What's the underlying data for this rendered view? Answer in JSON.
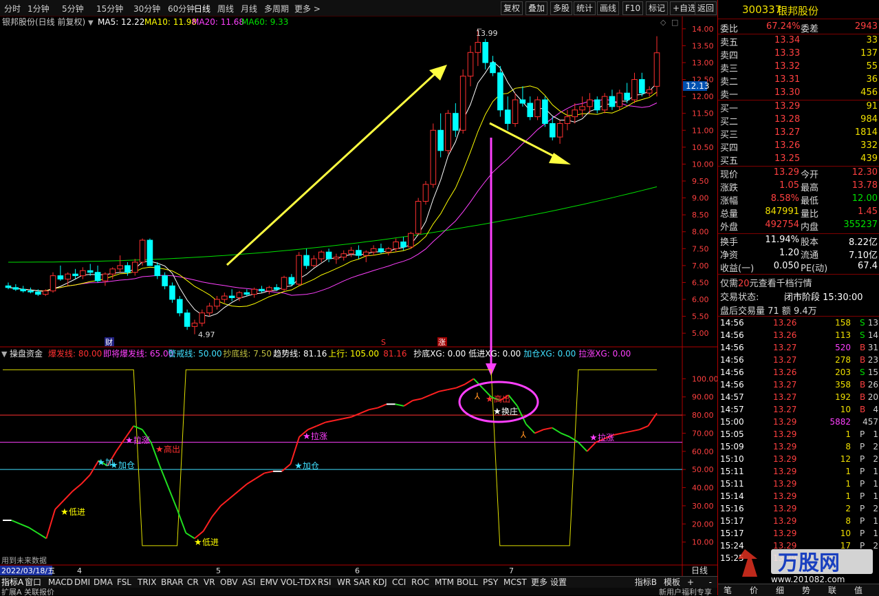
{
  "toolbar": {
    "periods": [
      "分时",
      "1分钟",
      "5分钟",
      "15分钟",
      "30分钟",
      "60分钟",
      "日线",
      "周线",
      "月线",
      "多周期",
      "更多 >"
    ],
    "active_period": "日线",
    "right_tools": [
      "复权",
      "叠加",
      "多股",
      "统计",
      "画线",
      "F10",
      "标记",
      "+自选",
      "返回"
    ]
  },
  "chart_header": {
    "title": "银邦股份(日线 前复权)",
    "ma5": "MA5: 12.22",
    "ma10": "MA10: 11.98",
    "ma20": "MA20: 11.68",
    "ma60": "MA60: 9.33"
  },
  "price_axis": {
    "ticks": [
      "14.00",
      "13.50",
      "13.00",
      "12.50",
      "12.00",
      "11.50",
      "11.00",
      "10.50",
      "10.00",
      "9.50",
      "9.00",
      "8.50",
      "8.00",
      "7.50",
      "7.00",
      "6.50",
      "6.00",
      "5.50",
      "5.00"
    ],
    "current_tag": "12.13",
    "high_marker": "13.99",
    "low_marker": "4.97"
  },
  "event_markers": [
    "财",
    "S",
    "涨"
  ],
  "indicator_header": {
    "name": "操盘资金",
    "items": [
      {
        "text": "爆发线: 80.00",
        "color": "#ff3030"
      },
      {
        "text": "即将爆发线: 65.00",
        "color": "#ff40ff"
      },
      {
        "text": "警戒线: 50.00",
        "color": "#40e0ff"
      },
      {
        "text": "抄底线: 7.50",
        "color": "#c0c040"
      },
      {
        "text": "趋势线: 81.16",
        "color": "#ffffff"
      },
      {
        "text": "上行: 105.00",
        "color": "#ffff00"
      },
      {
        "text": "81.16",
        "color": "#ff3030"
      },
      {
        "text": "抄底XG: 0.00",
        "color": "#ffffff"
      },
      {
        "text": "低进XG: 0.00",
        "color": "#ffffff"
      },
      {
        "text": "加仓XG: 0.00",
        "color": "#40e0ff"
      },
      {
        "text": "拉涨XG: 0.00",
        "color": "#ff40ff"
      }
    ]
  },
  "indicator_axis": {
    "ticks": [
      "100.00",
      "90.00",
      "80.00",
      "70.00",
      "60.00",
      "50.00",
      "40.00",
      "30.00",
      "20.00",
      "10.00"
    ]
  },
  "signals": {
    "low_entry": "低进",
    "add": "加仓",
    "add_short": "加",
    "rally": "拉涨",
    "rally_short": "拉涨",
    "high_out": "高出",
    "switch": "换庄"
  },
  "date_axis": {
    "start": "2022/03/18/五",
    "months": [
      "4",
      "5",
      "6",
      "7"
    ],
    "period_btn": "日线"
  },
  "future_note": "用到未来数据",
  "bottom_tabs": [
    "指标A",
    "窗口",
    "MACD",
    "DMI",
    "DMA",
    "FSL",
    "TRIX",
    "BRAR",
    "CR",
    "VR",
    "OBV",
    "ASI",
    "EMV",
    "VOL-TDX",
    "RSI",
    "WR",
    "SAR",
    "KDJ",
    "CCI",
    "ROC",
    "MTM",
    "BOLL",
    "PSY",
    "MCST",
    "更多",
    "设置"
  ],
  "bottom_right": [
    "指标B",
    "模板",
    "+",
    "-"
  ],
  "status_left": "扩展A  关联报价",
  "status_right": "新用户福利专享",
  "quote": {
    "code": "300337",
    "name": "银邦股份",
    "weibi_label": "委比",
    "weibi": "67.24%",
    "weicha_label": "委差",
    "weicha": "2943",
    "asks": [
      {
        "label": "卖五",
        "price": "13.34",
        "vol": "33"
      },
      {
        "label": "卖四",
        "price": "13.33",
        "vol": "137"
      },
      {
        "label": "卖三",
        "price": "13.32",
        "vol": "55"
      },
      {
        "label": "卖二",
        "price": "13.31",
        "vol": "36"
      },
      {
        "label": "卖一",
        "price": "13.30",
        "vol": "456"
      }
    ],
    "bids": [
      {
        "label": "买一",
        "price": "13.29",
        "vol": "91"
      },
      {
        "label": "买二",
        "price": "13.28",
        "vol": "984"
      },
      {
        "label": "买三",
        "price": "13.27",
        "vol": "1814"
      },
      {
        "label": "买四",
        "price": "13.26",
        "vol": "332"
      },
      {
        "label": "买五",
        "price": "13.25",
        "vol": "439"
      }
    ],
    "stats": [
      {
        "l1": "现价",
        "v1": "13.29",
        "c1": "red",
        "l2": "今开",
        "v2": "12.30",
        "c2": "red"
      },
      {
        "l1": "涨跌",
        "v1": "1.05",
        "c1": "red",
        "l2": "最高",
        "v2": "13.78",
        "c2": "red"
      },
      {
        "l1": "涨幅",
        "v1": "8.58%",
        "c1": "red",
        "l2": "最低",
        "v2": "12.00",
        "c2": "grn"
      },
      {
        "l1": "总量",
        "v1": "847991",
        "c1": "yel",
        "l2": "量比",
        "v2": "1.45",
        "c2": "red"
      },
      {
        "l1": "外盘",
        "v1": "492754",
        "c1": "red",
        "l2": "内盘",
        "v2": "355237",
        "c2": "grn"
      }
    ],
    "stats2": [
      {
        "l1": "换手",
        "v1": "11.94%",
        "l2": "股本",
        "v2": "8.22亿"
      },
      {
        "l1": "净资",
        "v1": "1.20",
        "l2": "流通",
        "v2": "7.10亿"
      },
      {
        "l1": "收益(一)",
        "v1": "0.050",
        "l2": "PE(动)",
        "v2": "67.4"
      }
    ],
    "promo": "仅需20元查看千档行情",
    "promo_hl": "20",
    "trade_status_label": "交易状态:",
    "trade_status": "闭市阶段 15:30:00",
    "after_hours": "盘后交易量 71 额 9.4万"
  },
  "ticks": [
    {
      "t": "14:56",
      "p": "13.26",
      "v": "158",
      "d": "S",
      "n": "13"
    },
    {
      "t": "14:56",
      "p": "13.26",
      "v": "113",
      "d": "S",
      "n": "14"
    },
    {
      "t": "14:56",
      "p": "13.27",
      "v": "520",
      "d": "B",
      "n": "31"
    },
    {
      "t": "14:56",
      "p": "13.27",
      "v": "278",
      "d": "B",
      "n": "23"
    },
    {
      "t": "14:56",
      "p": "13.26",
      "v": "203",
      "d": "S",
      "n": "15"
    },
    {
      "t": "14:56",
      "p": "13.27",
      "v": "358",
      "d": "B",
      "n": "26"
    },
    {
      "t": "14:57",
      "p": "13.27",
      "v": "192",
      "d": "B",
      "n": "20"
    },
    {
      "t": "14:57",
      "p": "13.27",
      "v": "10",
      "d": "B",
      "n": "4"
    },
    {
      "t": "15:00",
      "p": "13.29",
      "v": "5882",
      "d": "",
      "n": "457"
    },
    {
      "t": "15:05",
      "p": "13.29",
      "v": "1",
      "d": "P",
      "n": "1"
    },
    {
      "t": "15:09",
      "p": "13.29",
      "v": "8",
      "d": "P",
      "n": "2"
    },
    {
      "t": "15:10",
      "p": "13.29",
      "v": "12",
      "d": "P",
      "n": "2"
    },
    {
      "t": "15:11",
      "p": "13.29",
      "v": "1",
      "d": "P",
      "n": "1"
    },
    {
      "t": "15:11",
      "p": "13.29",
      "v": "1",
      "d": "P",
      "n": "1"
    },
    {
      "t": "15:14",
      "p": "13.29",
      "v": "1",
      "d": "P",
      "n": "1"
    },
    {
      "t": "15:16",
      "p": "13.29",
      "v": "2",
      "d": "P",
      "n": "2"
    },
    {
      "t": "15:17",
      "p": "13.29",
      "v": "8",
      "d": "P",
      "n": "1"
    },
    {
      "t": "15:17",
      "p": "13.29",
      "v": "10",
      "d": "P",
      "n": "1"
    },
    {
      "t": "15:24",
      "p": "13.29",
      "v": "17",
      "d": "P",
      "n": "2"
    },
    {
      "t": "15:25",
      "p": "13.29",
      "v": "",
      "d": "",
      "n": ""
    }
  ],
  "panel_tabs": [
    "笔",
    "价",
    "细",
    "势",
    "联",
    "值"
  ],
  "watermark": {
    "title": "万股网",
    "url": "www.201082.com"
  },
  "colors": {
    "up": "#ff3030",
    "down": "#00ffff",
    "ma5": "#ffffff",
    "ma10": "#ffff00",
    "ma20": "#ff40ff",
    "ma60": "#00e000",
    "frame": "#b00000"
  },
  "chart_data": {
    "type": "candlestick",
    "title": "银邦股份(日线 前复权)",
    "ylim": [
      4.8,
      14.2
    ],
    "x_months": [
      "4",
      "5",
      "6",
      "7"
    ],
    "ohlc": [
      [
        6.4,
        6.5,
        6.3,
        6.35
      ],
      [
        6.35,
        6.45,
        6.25,
        6.3
      ],
      [
        6.3,
        6.4,
        6.2,
        6.25
      ],
      [
        6.25,
        6.35,
        6.18,
        6.22
      ],
      [
        6.22,
        6.3,
        6.1,
        6.15
      ],
      [
        6.15,
        6.3,
        6.1,
        6.25
      ],
      [
        6.25,
        6.8,
        6.2,
        6.7
      ],
      [
        6.7,
        7.0,
        6.55,
        6.6
      ],
      [
        6.6,
        6.8,
        6.4,
        6.75
      ],
      [
        6.75,
        6.9,
        6.6,
        6.7
      ],
      [
        6.7,
        6.95,
        6.6,
        6.85
      ],
      [
        6.85,
        7.05,
        6.7,
        6.8
      ],
      [
        6.8,
        7.0,
        6.5,
        6.55
      ],
      [
        6.55,
        6.8,
        6.4,
        6.75
      ],
      [
        6.75,
        6.95,
        6.6,
        6.9
      ],
      [
        6.9,
        7.3,
        6.8,
        7.0
      ],
      [
        7.0,
        7.1,
        6.7,
        6.8
      ],
      [
        6.8,
        7.2,
        6.7,
        7.1
      ],
      [
        7.1,
        7.8,
        7.0,
        7.75
      ],
      [
        7.75,
        7.8,
        7.0,
        7.0
      ],
      [
        7.0,
        7.1,
        6.6,
        6.7
      ],
      [
        6.7,
        6.8,
        6.3,
        6.4
      ],
      [
        6.4,
        6.5,
        5.9,
        6.0
      ],
      [
        6.0,
        6.1,
        5.5,
        5.6
      ],
      [
        5.6,
        5.7,
        5.1,
        5.2
      ],
      [
        5.2,
        5.4,
        4.97,
        5.3
      ],
      [
        5.3,
        5.7,
        5.2,
        5.6
      ],
      [
        5.6,
        5.9,
        5.5,
        5.8
      ],
      [
        5.8,
        6.1,
        5.7,
        6.0
      ],
      [
        6.0,
        6.2,
        5.9,
        6.1
      ],
      [
        6.1,
        6.3,
        5.95,
        6.05
      ],
      [
        6.05,
        6.25,
        5.95,
        6.2
      ],
      [
        6.2,
        6.3,
        6.1,
        6.15
      ],
      [
        6.15,
        6.35,
        6.05,
        6.3
      ],
      [
        6.3,
        6.4,
        6.2,
        6.25
      ],
      [
        6.25,
        6.4,
        6.15,
        6.35
      ],
      [
        6.35,
        6.45,
        6.25,
        6.3
      ],
      [
        6.3,
        6.7,
        6.25,
        6.65
      ],
      [
        6.65,
        6.75,
        6.4,
        6.45
      ],
      [
        6.45,
        7.4,
        6.4,
        7.3
      ],
      [
        7.3,
        7.5,
        6.9,
        7.0
      ],
      [
        7.0,
        7.3,
        6.95,
        7.2
      ],
      [
        7.2,
        7.45,
        7.1,
        7.4
      ],
      [
        7.4,
        7.5,
        7.1,
        7.2
      ],
      [
        7.2,
        7.35,
        7.05,
        7.25
      ],
      [
        7.25,
        7.45,
        7.15,
        7.35
      ],
      [
        7.35,
        7.55,
        7.25,
        7.45
      ],
      [
        7.45,
        7.6,
        7.2,
        7.3
      ],
      [
        7.3,
        7.45,
        7.1,
        7.4
      ],
      [
        7.4,
        7.6,
        7.3,
        7.5
      ],
      [
        7.5,
        7.65,
        7.35,
        7.4
      ],
      [
        7.4,
        7.55,
        7.3,
        7.5
      ],
      [
        7.5,
        7.8,
        7.4,
        7.7
      ],
      [
        7.7,
        7.85,
        7.45,
        7.55
      ],
      [
        7.55,
        8.0,
        7.5,
        7.95
      ],
      [
        7.95,
        9.0,
        7.9,
        8.9
      ],
      [
        8.9,
        9.5,
        8.8,
        9.4
      ],
      [
        9.4,
        11.2,
        9.3,
        11.0
      ],
      [
        11.0,
        11.5,
        10.2,
        10.4
      ],
      [
        10.4,
        11.6,
        10.3,
        11.5
      ],
      [
        11.5,
        11.8,
        10.8,
        11.0
      ],
      [
        11.0,
        12.8,
        10.9,
        12.6
      ],
      [
        12.6,
        13.5,
        12.3,
        13.3
      ],
      [
        13.3,
        13.99,
        12.9,
        13.6
      ],
      [
        13.6,
        13.7,
        12.8,
        13.0
      ],
      [
        13.0,
        13.2,
        12.6,
        12.7
      ],
      [
        12.7,
        12.9,
        11.4,
        11.6
      ],
      [
        11.6,
        12.0,
        11.0,
        11.2
      ],
      [
        11.2,
        12.1,
        11.1,
        11.9
      ],
      [
        11.9,
        12.3,
        11.7,
        11.8
      ],
      [
        11.8,
        12.0,
        11.3,
        11.4
      ],
      [
        11.4,
        12.0,
        11.3,
        11.9
      ],
      [
        11.9,
        12.0,
        11.1,
        11.2
      ],
      [
        11.2,
        11.4,
        10.7,
        10.8
      ],
      [
        10.8,
        11.3,
        10.6,
        11.2
      ],
      [
        11.2,
        11.6,
        11.0,
        11.4
      ],
      [
        11.4,
        11.8,
        11.2,
        11.6
      ],
      [
        11.6,
        12.0,
        11.4,
        11.7
      ],
      [
        11.7,
        12.1,
        11.5,
        11.9
      ],
      [
        11.9,
        12.0,
        11.5,
        11.6
      ],
      [
        11.6,
        12.1,
        11.5,
        12.0
      ],
      [
        12.0,
        12.2,
        11.6,
        11.7
      ],
      [
        11.7,
        12.2,
        11.6,
        12.1
      ],
      [
        12.1,
        12.4,
        11.8,
        11.9
      ],
      [
        11.9,
        12.7,
        11.8,
        12.5
      ],
      [
        12.5,
        12.7,
        12.0,
        12.1
      ],
      [
        12.1,
        12.3,
        12.0,
        12.2
      ],
      [
        12.3,
        13.78,
        12.0,
        13.29
      ]
    ],
    "ma60_start": 7.1,
    "ma60_end": 9.33,
    "indicator": {
      "name": "操盘资金",
      "ylim": [
        0,
        110
      ],
      "levels": [
        80,
        65,
        50
      ],
      "trend": [
        22,
        22,
        20,
        18,
        15,
        12,
        28,
        33,
        38,
        42,
        47,
        55,
        52,
        60,
        67,
        74,
        72,
        65,
        52,
        40,
        28,
        15,
        12,
        16,
        24,
        30,
        34,
        38,
        42,
        45,
        48,
        49,
        49,
        53,
        68,
        72,
        74,
        76,
        77,
        78,
        79,
        81,
        83,
        84,
        86,
        86,
        85,
        88,
        89,
        91,
        93,
        94,
        95,
        97,
        100,
        95,
        90,
        88,
        91,
        85,
        75,
        70,
        72,
        73,
        70,
        68,
        65,
        60,
        65,
        67,
        69,
        70,
        71,
        72,
        74,
        81
      ],
      "channel": [
        105,
        105,
        105,
        105,
        105,
        105,
        105,
        105,
        105,
        105,
        105,
        105,
        105,
        105,
        105,
        105,
        8,
        8,
        8,
        8,
        8,
        105,
        105,
        105,
        105,
        105,
        105,
        105,
        105,
        105,
        105,
        105,
        105,
        105,
        105,
        105,
        105,
        105,
        105,
        105,
        105,
        105,
        105,
        105,
        105,
        105,
        105,
        105,
        105,
        105,
        105,
        105,
        105,
        105,
        105,
        105,
        105,
        8,
        8,
        8,
        8,
        8,
        8,
        8,
        8,
        8,
        105,
        105,
        105,
        105,
        105,
        105,
        105,
        105,
        105,
        105
      ]
    }
  }
}
